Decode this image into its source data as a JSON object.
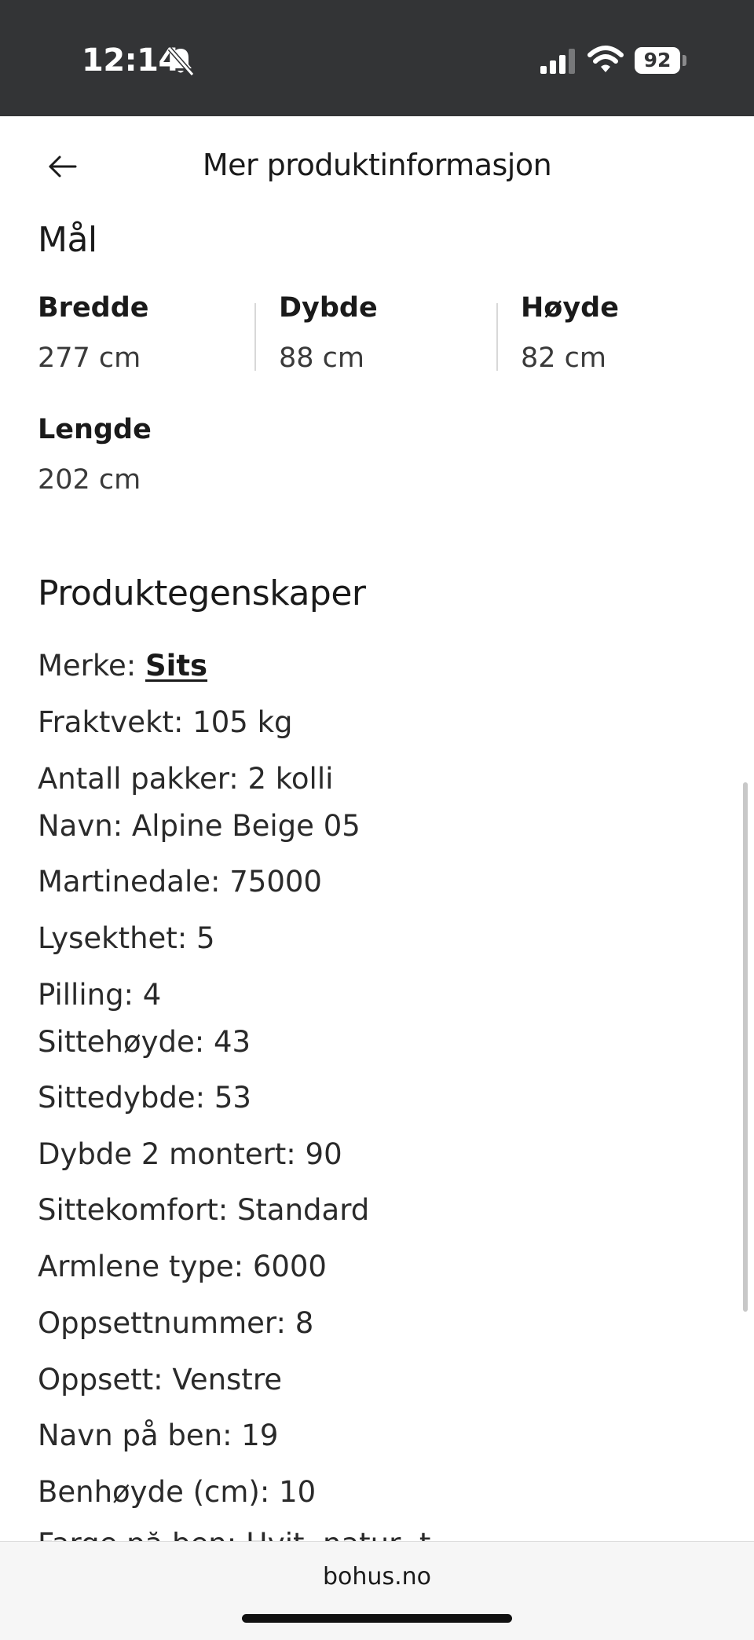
{
  "status_bar": {
    "time": "12:14",
    "battery": "92"
  },
  "header": {
    "title": "Mer produktinformasjon"
  },
  "dimensions": {
    "heading": "Mål",
    "items": [
      {
        "label": "Bredde",
        "value": "277 cm"
      },
      {
        "label": "Dybde",
        "value": "88 cm"
      },
      {
        "label": "Høyde",
        "value": "82 cm"
      },
      {
        "label": "Lengde",
        "value": "202 cm"
      }
    ]
  },
  "properties": {
    "heading": "Produktegenskaper",
    "brand_label": "Merke: ",
    "brand_link": "Sits",
    "items": [
      "Fraktvekt: 105 kg",
      "Antall pakker: 2 kolli",
      "Navn: Alpine Beige 05",
      "Martinedale: 75000",
      "Lysekthet: 5",
      "Pilling: 4",
      "Sittehøyde: 43",
      "Sittedybde: 53",
      "Dybde 2 montert: 90",
      "Sittekomfort: Standard",
      "Armlene type: 6000",
      "Oppsettnummer: 8",
      "Oppsett: Venstre",
      "Navn på ben: 19",
      "Benhøyde (cm): 10"
    ],
    "clipped_item": "Farge på ben: Hvit, natur, t"
  },
  "browser": {
    "url": "bohus.no"
  },
  "icons": {
    "back": "arrow-left-icon",
    "bell": "bell-slash-icon",
    "signal": "cellular-signal-icon",
    "wifi": "wifi-icon"
  }
}
